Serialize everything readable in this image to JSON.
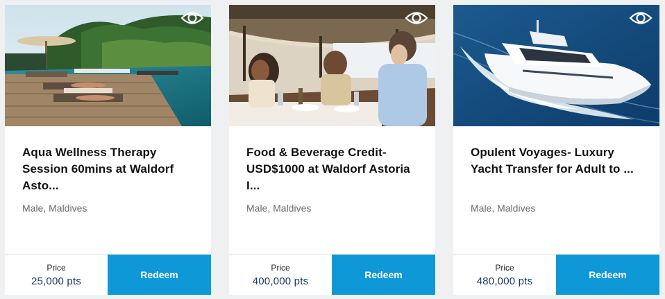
{
  "cards": [
    {
      "title": "Aqua Wellness Therapy Session 60mins at Waldorf Asto...",
      "location": "Male, Maldives",
      "price_label": "Price",
      "price_value": "25,000 pts",
      "redeem_label": "Redeem",
      "image_subject": "resort infinity pool with sun loungers",
      "view_icon": "eye-icon"
    },
    {
      "title": "Food & Beverage Credit- USD$1000 at Waldorf Astoria I...",
      "location": "Male, Maldives",
      "price_label": "Price",
      "price_value": "400,000 pts",
      "redeem_label": "Redeem",
      "image_subject": "people dining at an outdoor thatched restaurant",
      "view_icon": "eye-icon"
    },
    {
      "title": "Opulent Voyages- Luxury Yacht Transfer for Adult to ...",
      "location": "Male, Maldives",
      "price_label": "Price",
      "price_value": "480,000 pts",
      "redeem_label": "Redeem",
      "image_subject": "white luxury yacht cruising on blue ocean",
      "view_icon": "eye-icon"
    }
  ],
  "colors": {
    "redeem_button": "#0f98d8",
    "price_value": "#1b3a66",
    "location_text": "#6b6b6b",
    "page_background": "#eef0f2"
  }
}
